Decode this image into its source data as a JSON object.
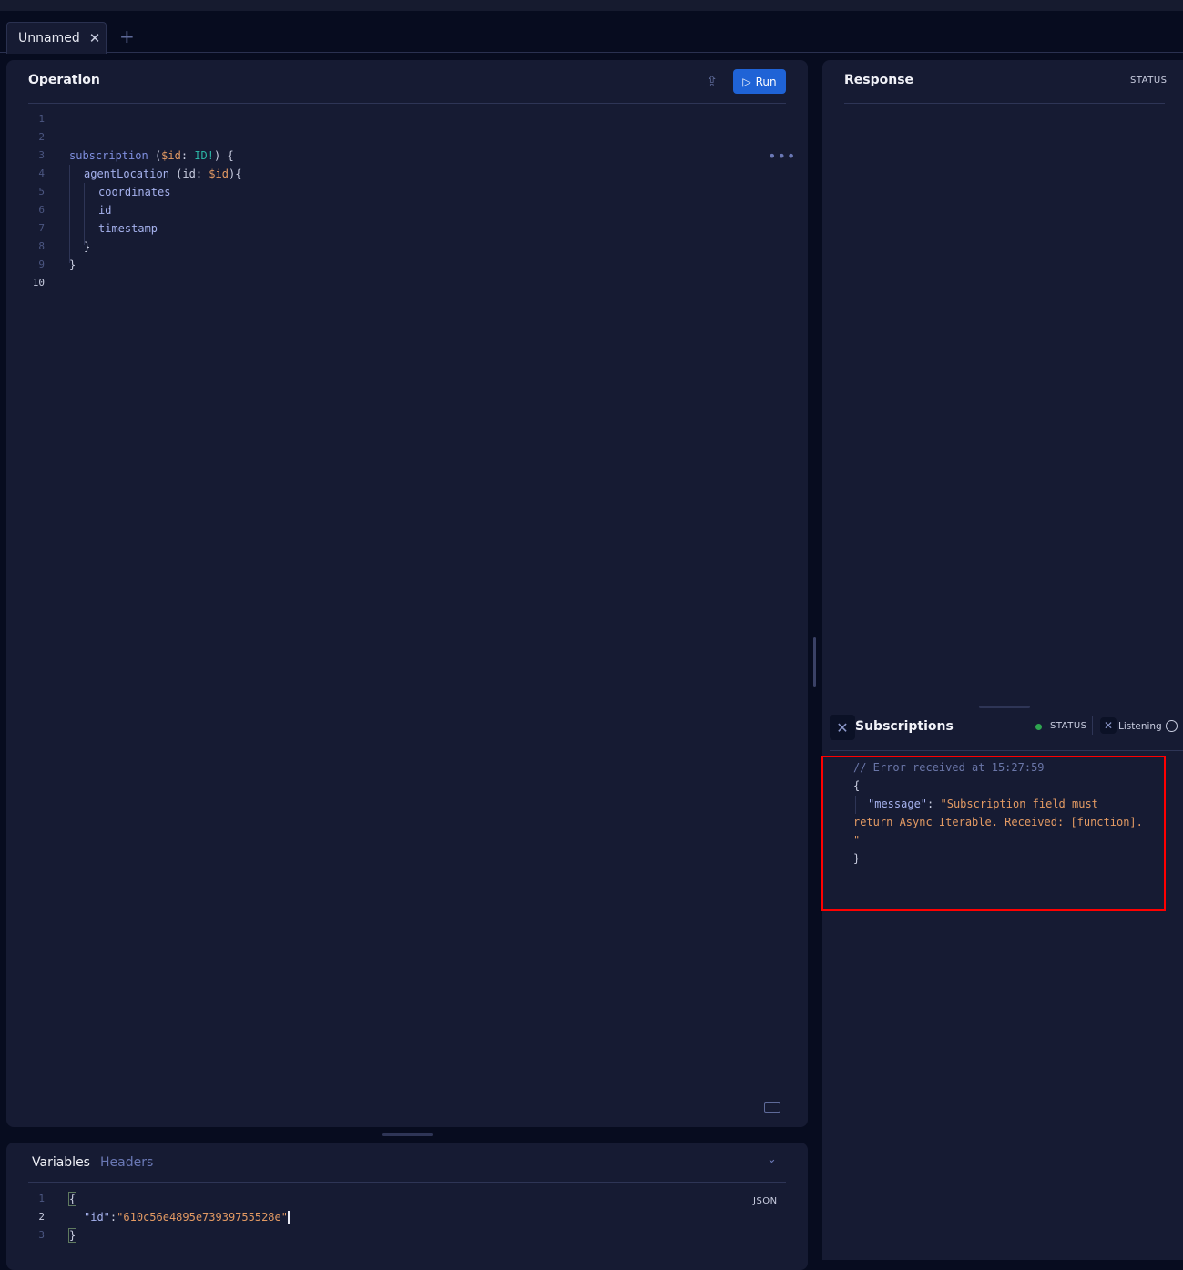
{
  "tabs": [
    {
      "label": "Unnamed"
    }
  ],
  "operation": {
    "title": "Operation",
    "run_label": "Run",
    "line_numbers": [
      "1",
      "2",
      "3",
      "4",
      "5",
      "6",
      "7",
      "8",
      "9",
      "10"
    ],
    "code": {
      "l3_kw": "subscription",
      "l3_open": "(",
      "l3_var": "$id",
      "l3_colon": ":",
      "l3_type": "ID!",
      "l3_close": ") {",
      "l4_field": "agentLocation",
      "l4_args": "(id:",
      "l4_var": "$id",
      "l4_close": "){",
      "l5": "coordinates",
      "l6": "id",
      "l7": "timestamp",
      "l8": "}",
      "l9": "}"
    }
  },
  "response": {
    "title": "Response",
    "status": "STATUS"
  },
  "subscriptions": {
    "title": "Subscriptions",
    "status": "STATUS",
    "listening": "Listening",
    "status_color": "#2ea44f",
    "comment": "// Error received at 15:27:59",
    "open": "{",
    "key": "\"message\"",
    "colon": ":",
    "message_1": "\"Subscription field must",
    "message_2": "return Async Iterable. Received: [function].",
    "message_3": "\"",
    "close": "}"
  },
  "variables": {
    "tab_variables": "Variables",
    "tab_headers": "Headers",
    "format": "JSON",
    "line_numbers": [
      "1",
      "2",
      "3"
    ],
    "open": "{",
    "key": "\"id\"",
    "colon": ":",
    "value": "\"610c56e4895e73939755528e\"",
    "close": "}"
  }
}
